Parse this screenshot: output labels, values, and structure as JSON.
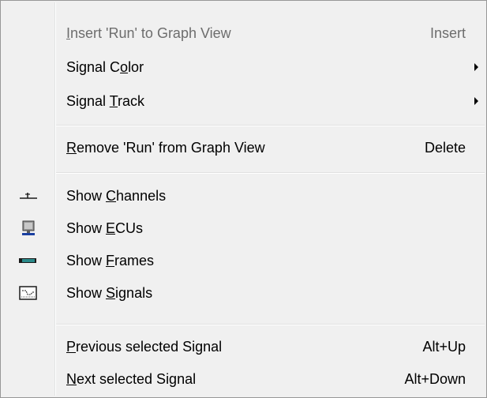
{
  "menu": {
    "items": [
      {
        "pre": "",
        "key": "I",
        "post": "nsert 'Run' to Graph View",
        "shortcut": "Insert",
        "disabled": true
      },
      {
        "pre": "Signal C",
        "key": "o",
        "post": "lor",
        "submenu": true
      },
      {
        "pre": "Signal ",
        "key": "T",
        "post": "rack",
        "submenu": true
      },
      {
        "pre": "",
        "key": "R",
        "post": "emove 'Run' from Graph View",
        "shortcut": "Delete"
      },
      {
        "pre": "Show ",
        "key": "C",
        "post": "hannels",
        "icon": "channel-icon"
      },
      {
        "pre": "Show ",
        "key": "E",
        "post": "CUs",
        "icon": "ecu-monitor-icon"
      },
      {
        "pre": "Show ",
        "key": "F",
        "post": "rames",
        "icon": "frame-icon"
      },
      {
        "pre": "Show ",
        "key": "S",
        "post": "ignals",
        "icon": "signal-chart-icon"
      },
      {
        "pre": "",
        "key": "P",
        "post": "revious selected Signal",
        "shortcut": "Alt+Up"
      },
      {
        "pre": "",
        "key": "N",
        "post": "ext selected Signal",
        "shortcut": "Alt+Down"
      }
    ]
  },
  "colors": {
    "background": "#f0f0f0",
    "disabled_text": "#6d6d6d",
    "monitor_blue": "#1a3fa0",
    "frame_teal": "#2a8a8a"
  }
}
